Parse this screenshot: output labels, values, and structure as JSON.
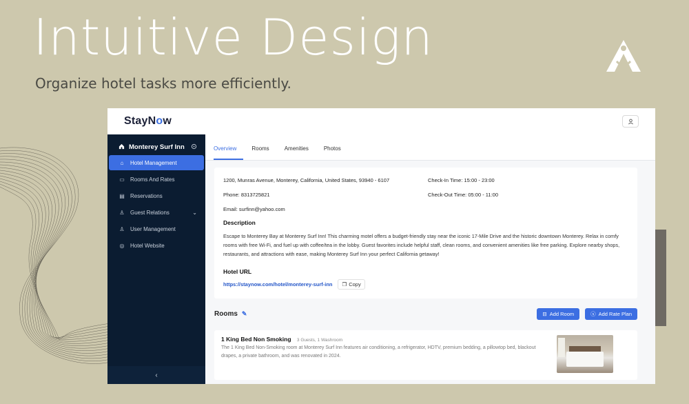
{
  "hero": {
    "title": "Intuitive Design",
    "subtitle": "Organize hotel tasks more efficiently."
  },
  "app": {
    "logo": "StayNow",
    "user_icon": "user-icon"
  },
  "sidebar": {
    "hotel_name": "Monterey Surf Inn",
    "items": [
      {
        "label": "Hotel Management",
        "icon": "home-icon",
        "active": true
      },
      {
        "label": "Rooms And Rates",
        "icon": "bed-icon"
      },
      {
        "label": "Reservations",
        "icon": "calendar-icon"
      },
      {
        "label": "Guest Relations",
        "icon": "person-icon",
        "has_chevron": true
      },
      {
        "label": "User Management",
        "icon": "person-icon"
      },
      {
        "label": "Hotel Website",
        "icon": "globe-icon"
      }
    ],
    "collapse": "‹"
  },
  "tabs": [
    {
      "label": "Overview",
      "active": true
    },
    {
      "label": "Rooms"
    },
    {
      "label": "Amenities"
    },
    {
      "label": "Photos"
    }
  ],
  "overview": {
    "address": "1200, Munras Avenue, Monterey, California, United States, 93940 - 6107",
    "check_in": "Check-In Time:   15:00 - 23:00",
    "phone": "Phone:  8313725821",
    "check_out": "Check-Out Time:  05:00 - 11:00",
    "email": "Email:  surfinn@yahoo.com",
    "description_title": "Description",
    "description": "Escape to Monterey Bay at Monterey Surf Inn! This charming motel offers a budget-friendly stay near the iconic 17-Mile Drive and the historic downtown Monterey. Relax in comfy rooms with free Wi-Fi, and fuel up with coffee/tea in the lobby. Guest favorites include helpful staff, clean rooms, and convenient amenities like free parking. Explore nearby shops, restaurants, and attractions with ease, making Monterey Surf Inn your perfect California getaway!",
    "url_title": "Hotel URL",
    "url": "https://staynow.com/hotel/monterey-surf-inn",
    "copy_label": "Copy"
  },
  "rooms": {
    "title": "Rooms",
    "add_room": "Add Room",
    "add_rate_plan": "Add Rate Plan",
    "list": [
      {
        "name": "1 King Bed Non Smoking",
        "meta": "3 Guests, 1 Washroom",
        "description": "The 1 King Bed Non-Smoking room at Monterey Surf Inn features air conditioning, a refrigerator, HDTV, premium bedding, a pillowtop bed, blackout drapes, a private bathroom, and was renovated in 2024."
      }
    ]
  },
  "colors": {
    "background": "#cdc8ad",
    "sidebar": "#0b1c31",
    "accent": "#3c6ee2"
  }
}
